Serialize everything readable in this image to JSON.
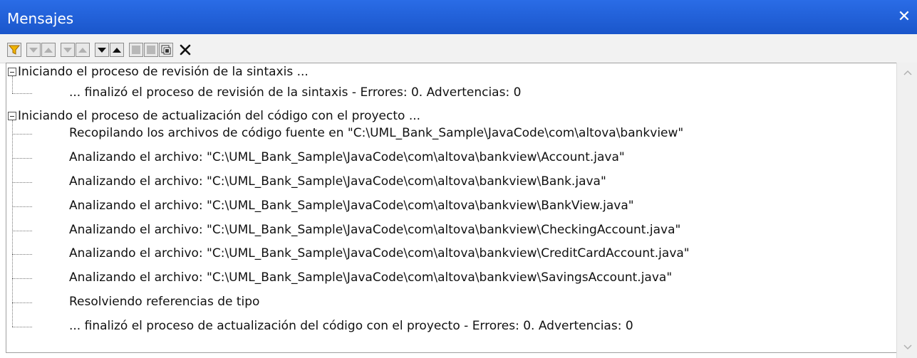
{
  "window": {
    "title": "Mensajes",
    "close_label": "✕"
  },
  "toolbar": {
    "buttons": [
      {
        "name": "filter-button",
        "icon": "filter-icon"
      },
      {
        "name": "next-button",
        "icon": "arrow-down-icon"
      },
      {
        "name": "previous-button",
        "icon": "arrow-up-icon"
      },
      {
        "name": "next-error-button",
        "icon": "arrow-down-icon"
      },
      {
        "name": "previous-error-button",
        "icon": "arrow-up-icon"
      },
      {
        "name": "next-warning-button",
        "icon": "arrow-down-icon"
      },
      {
        "name": "previous-warning-button",
        "icon": "arrow-up-icon"
      },
      {
        "name": "copy-line-button",
        "icon": "copy-icon"
      },
      {
        "name": "copy-branch-button",
        "icon": "copy-icon"
      },
      {
        "name": "copy-all-button",
        "icon": "copy-all-icon"
      },
      {
        "name": "clear-button",
        "icon": "delete-icon"
      }
    ]
  },
  "messages": {
    "groups": [
      {
        "header": "Iniciando el proceso de revisión de la sintaxis ...",
        "items": [
          "... finalizó el proceso de revisión de la sintaxis - Errores: 0. Advertencias: 0"
        ]
      },
      {
        "header": "Iniciando el proceso de actualización del código con el proyecto ...",
        "items": [
          "Recopilando los archivos de código fuente en \"C:\\UML_Bank_Sample\\JavaCode\\com\\altova\\bankview\"",
          "Analizando el archivo: \"C:\\UML_Bank_Sample\\JavaCode\\com\\altova\\bankview\\Account.java\"",
          "Analizando el archivo: \"C:\\UML_Bank_Sample\\JavaCode\\com\\altova\\bankview\\Bank.java\"",
          "Analizando el archivo: \"C:\\UML_Bank_Sample\\JavaCode\\com\\altova\\bankview\\BankView.java\"",
          "Analizando el archivo: \"C:\\UML_Bank_Sample\\JavaCode\\com\\altova\\bankview\\CheckingAccount.java\"",
          "Analizando el archivo: \"C:\\UML_Bank_Sample\\JavaCode\\com\\altova\\bankview\\CreditCardAccount.java\"",
          "Analizando el archivo: \"C:\\UML_Bank_Sample\\JavaCode\\com\\altova\\bankview\\SavingsAccount.java\"",
          "Resolviendo referencias de tipo",
          "... finalizó el proceso de actualización del código con el proyecto - Errores: 0. Advertencias: 0"
        ]
      }
    ]
  }
}
